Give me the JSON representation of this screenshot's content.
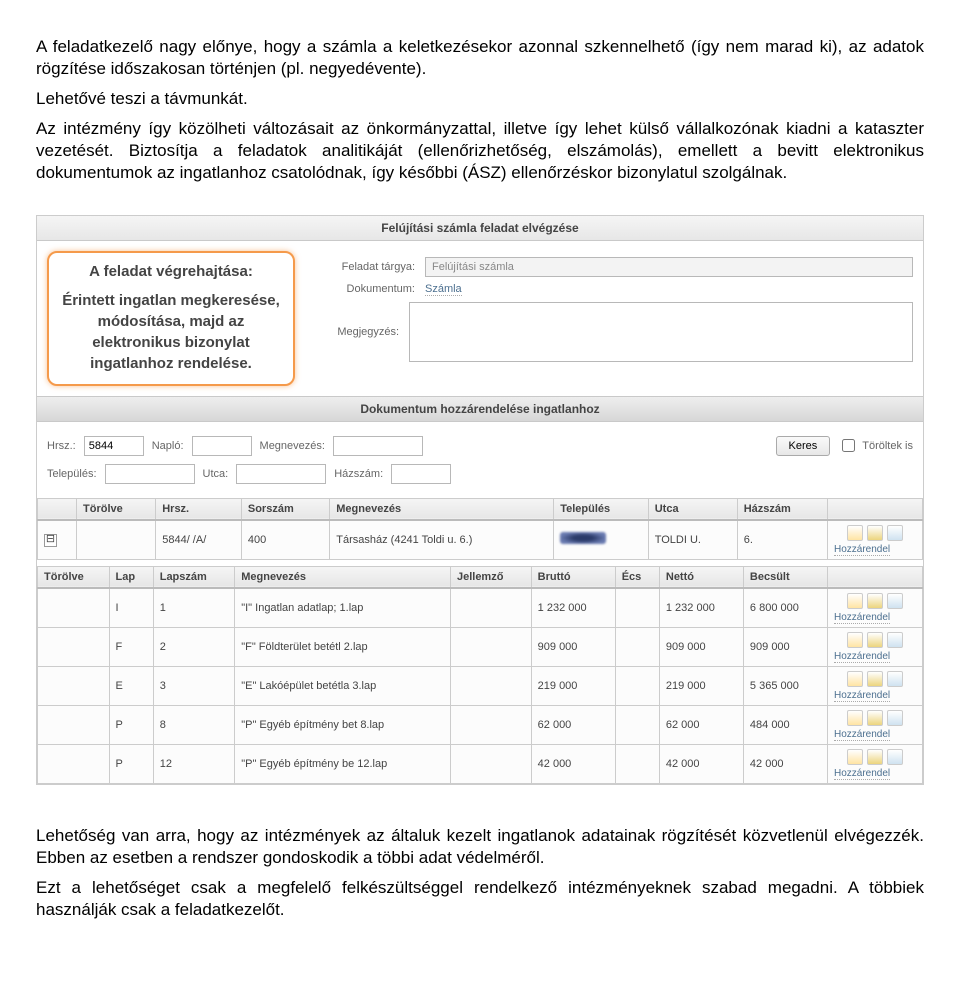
{
  "paragraphs": {
    "p1": "A feladatkezelő nagy előnye, hogy a számla a keletkezésekor azonnal szkennelhető (így nem marad ki), az adatok rögzítése időszakosan történjen (pl. negyedévente).",
    "p2": "Lehetővé teszi a távmunkát.",
    "p3": "Az intézmény így közölheti változásait az önkormányzattal, illetve így lehet külső vállalkozónak kiadni a kataszter vezetését. Biztosítja a feladatok analitikáját (ellenőrizhetőség, elszámolás), emellett a bevitt elektronikus dokumentumok az ingatlanhoz csatolódnak, így későbbi (ÁSZ) ellenőrzéskor bizonylatul szolgálnak.",
    "p4": "Lehetőség van arra, hogy az intézmények az általuk kezelt ingatlanok adatainak rögzítését közvetlenül elvégezzék. Ebben az esetben a rendszer gondoskodik a többi adat védelméről.",
    "p5": "Ezt a lehetőséget csak a megfelelő felkészültséggel rendelkező intézményeknek szabad megadni. A többiek használják csak a feladatkezelőt."
  },
  "window": {
    "title": "Felújítási számla feladat elvégzése",
    "section": "Dokumentum hozzárendelése ingatlanhoz"
  },
  "callout": {
    "title": "A feladat végrehajtása:",
    "body": "Érintett ingatlan megkeresése, módosítása, majd az elektronikus bizonylat ingatlanhoz rendelése."
  },
  "form": {
    "targya_label": "Feladat tárgya:",
    "targya_value": "Felújítási számla",
    "dokumentum_label": "Dokumentum:",
    "dokumentum_value": "Számla",
    "megjegyzes_label": "Megjegyzés:"
  },
  "search": {
    "hrsz_label": "Hrsz.:",
    "hrsz_value": "5844",
    "naplo_label": "Napló:",
    "telepules_label": "Település:",
    "utca_label": "Utca:",
    "megnevezes_label": "Megnevezés:",
    "hazszam_label": "Házszám:",
    "keres_label": "Keres",
    "toroltek_label": "Töröltek is"
  },
  "grid1": {
    "cols": [
      "",
      "Törölve",
      "Hrsz.",
      "Sorszám",
      "Megnevezés",
      "Település",
      "Utca",
      "Házszám",
      ""
    ],
    "row": {
      "expander": "⊟",
      "torolve": "",
      "hrsz": "5844/ /A/",
      "sorszam": "400",
      "megnevezes": "Társasház (4241 Toldi u. 6.)",
      "utca": "TOLDI U.",
      "hazszam": "6."
    }
  },
  "grid2": {
    "cols": [
      "Törölve",
      "Lap",
      "Lapszám",
      "Megnevezés",
      "Jellemző",
      "Bruttó",
      "Écs",
      "Nettó",
      "Becsült",
      ""
    ],
    "rows": [
      {
        "lap": "I",
        "lapszam": "1",
        "megnevezes": "\"I\" Ingatlan adatlap; 1.lap",
        "brutto": "1 232 000",
        "netto": "1 232 000",
        "becsult": "6 800 000"
      },
      {
        "lap": "F",
        "lapszam": "2",
        "megnevezes": "\"F\" Földterület betétl 2.lap",
        "brutto": "909 000",
        "netto": "909 000",
        "becsult": "909 000"
      },
      {
        "lap": "E",
        "lapszam": "3",
        "megnevezes": "\"E\" Lakóépület betétla 3.lap",
        "brutto": "219 000",
        "netto": "219 000",
        "becsult": "5 365 000"
      },
      {
        "lap": "P",
        "lapszam": "8",
        "megnevezes": "\"P\" Egyéb építmény bet 8.lap",
        "brutto": "62 000",
        "netto": "62 000",
        "becsult": "484 000"
      },
      {
        "lap": "P",
        "lapszam": "12",
        "megnevezes": "\"P\" Egyéb építmény be 12.lap",
        "brutto": "42 000",
        "netto": "42 000",
        "becsult": "42 000"
      }
    ]
  },
  "ops": {
    "link": "Hozzárendel"
  }
}
